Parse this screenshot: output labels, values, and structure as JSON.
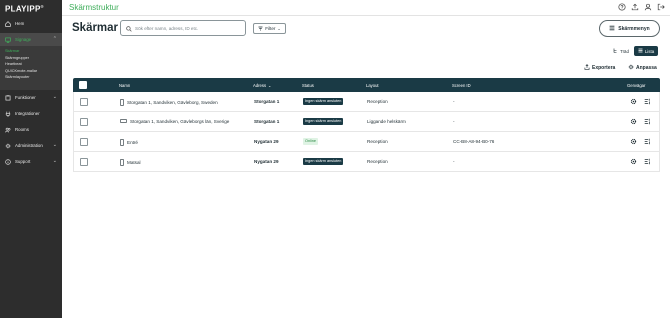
{
  "app": {
    "logo": "PLAYIPP",
    "logo_tag": "®",
    "breadcrumb": "Skärmstruktur"
  },
  "sidebar": {
    "items": [
      {
        "label": "Hem",
        "icon": "home-icon"
      },
      {
        "label": "Signage",
        "icon": "signage-icon",
        "active": true,
        "expanded": true
      },
      {
        "label": "Funktioner",
        "icon": "puzzle-icon"
      },
      {
        "label": "Integrationer",
        "icon": "plug-icon"
      },
      {
        "label": "Rooms",
        "icon": "rooms-icon"
      },
      {
        "label": "Administration",
        "icon": "gear-icon"
      },
      {
        "label": "Support",
        "icon": "info-icon"
      }
    ],
    "subitems": [
      {
        "label": "Skärmar",
        "active": true
      },
      {
        "label": "Skärmgrupper"
      },
      {
        "label": "Heartbeat"
      },
      {
        "label": "QUICKmote-mallar"
      },
      {
        "label": "Skärmlayouter"
      }
    ]
  },
  "header": {
    "title": "Skärmar",
    "search_placeholder": "Sök efter namn, adress, ID etc.",
    "filter_label": "Filter",
    "menu_label": "Skärmmenyn"
  },
  "view_toggle": {
    "tree_label": "Träd",
    "list_label": "Lista",
    "selected": "list"
  },
  "actions": {
    "export_label": "Exportera",
    "customize_label": "Anpassa"
  },
  "table": {
    "columns": [
      "Namn",
      "Adress",
      "Status",
      "Layout",
      "Screen ID",
      "Genvägar"
    ],
    "sort_column": "Adress",
    "rows": [
      {
        "name": "Storgatan 1, Sandviken, Gävleborg, Sweden",
        "device": "portrait",
        "address": "Storgatan 1",
        "status": "Ingen skärm ansluten",
        "status_type": "off",
        "layout": "Reception",
        "screen_id": "-"
      },
      {
        "name": "Storgatan 1, Sandviken, Gävleborgs län, Sverige",
        "device": "landscape",
        "address": "Storgatan 1",
        "status": "Ingen skärm ansluten",
        "status_type": "off",
        "layout": "Liggande helskärm",
        "screen_id": "-"
      },
      {
        "name": "Entré",
        "device": "portrait",
        "address": "Nygatan 29",
        "status": "Online",
        "status_type": "on",
        "layout": "Reception",
        "screen_id": "CC-B8-A8-94-B0-76"
      },
      {
        "name": "Matsal",
        "device": "portrait",
        "address": "Nygatan 29",
        "status": "Ingen skärm ansluten",
        "status_type": "off",
        "layout": "Reception",
        "screen_id": "-"
      }
    ]
  },
  "colors": {
    "brand_green": "#3fae5b",
    "header_dark": "#1a3a45",
    "sidebar_bg": "#2d2d2d"
  }
}
